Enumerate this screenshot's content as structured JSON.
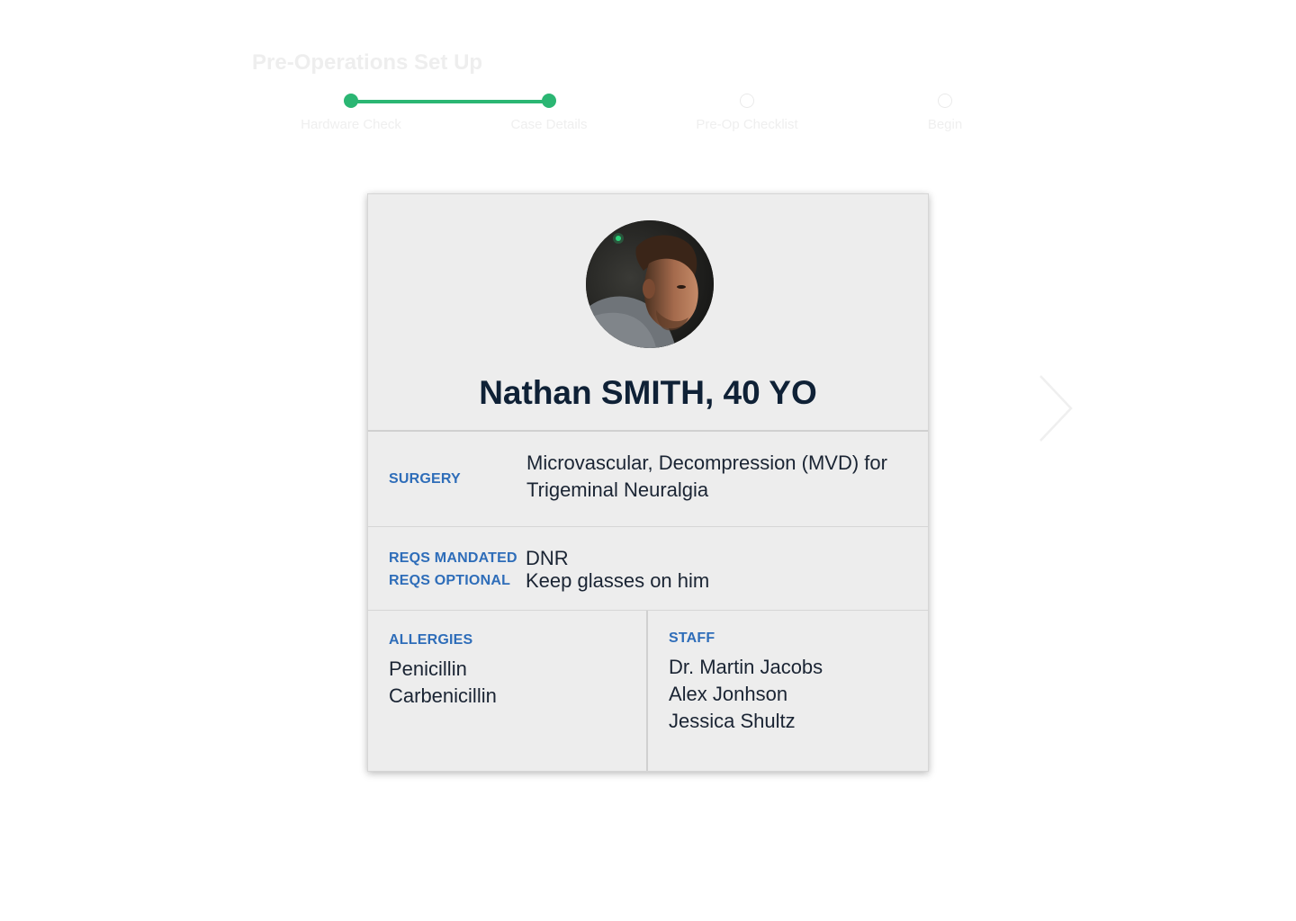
{
  "header": {
    "title": "Pre-Operations Set Up"
  },
  "stepper": {
    "steps": [
      {
        "label": "Hardware Check",
        "status": "done"
      },
      {
        "label": "Case Details",
        "status": "done"
      },
      {
        "label": "Pre-Op Checklist",
        "status": "todo"
      },
      {
        "label": "Begin",
        "status": "todo"
      }
    ],
    "accent_color": "#2bb673"
  },
  "patient": {
    "name": "Nathan SMITH, 40 YO",
    "surgery_label": "SURGERY",
    "surgery_lines": [
      "Microvascular, Decompression (MVD) for",
      "Trigeminal Neuralgia"
    ],
    "reqs_mandated_label": "REQS MANDATED",
    "reqs_mandated_value": "DNR",
    "reqs_optional_label": "REQS OPTIONAL",
    "reqs_optional_value": "Keep glasses on him",
    "allergies_label": "ALLERGIES",
    "allergies": [
      "Penicillin",
      "Carbenicillin"
    ],
    "staff_label": "STAFF",
    "staff": [
      "Dr. Martin Jacobs",
      "Alex Jonhson",
      "Jessica Shultz"
    ]
  },
  "colors": {
    "label_blue": "#2e6db9",
    "name_navy": "#0f2136",
    "card_bg": "#ededed"
  },
  "icons": {
    "next": "chevron-right-icon"
  }
}
